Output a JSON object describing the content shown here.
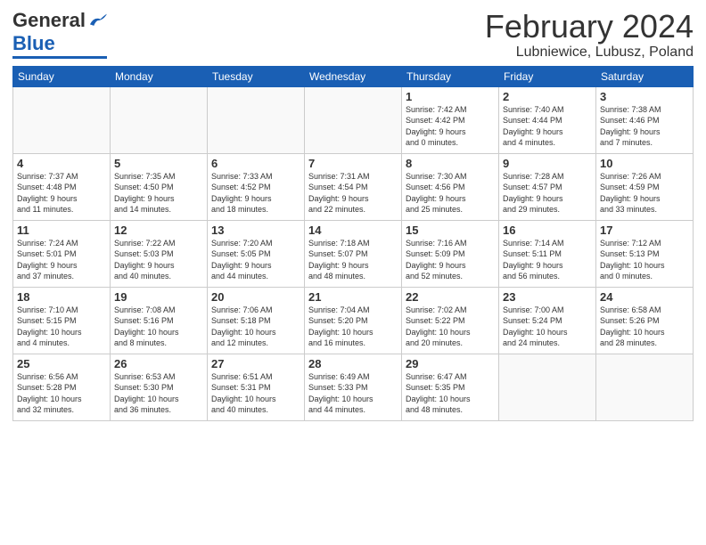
{
  "header": {
    "logo_general": "General",
    "logo_blue": "Blue",
    "month": "February 2024",
    "location": "Lubniewice, Lubusz, Poland"
  },
  "weekdays": [
    "Sunday",
    "Monday",
    "Tuesday",
    "Wednesday",
    "Thursday",
    "Friday",
    "Saturday"
  ],
  "weeks": [
    [
      {
        "day": "",
        "info": ""
      },
      {
        "day": "",
        "info": ""
      },
      {
        "day": "",
        "info": ""
      },
      {
        "day": "",
        "info": ""
      },
      {
        "day": "1",
        "info": "Sunrise: 7:42 AM\nSunset: 4:42 PM\nDaylight: 9 hours\nand 0 minutes."
      },
      {
        "day": "2",
        "info": "Sunrise: 7:40 AM\nSunset: 4:44 PM\nDaylight: 9 hours\nand 4 minutes."
      },
      {
        "day": "3",
        "info": "Sunrise: 7:38 AM\nSunset: 4:46 PM\nDaylight: 9 hours\nand 7 minutes."
      }
    ],
    [
      {
        "day": "4",
        "info": "Sunrise: 7:37 AM\nSunset: 4:48 PM\nDaylight: 9 hours\nand 11 minutes."
      },
      {
        "day": "5",
        "info": "Sunrise: 7:35 AM\nSunset: 4:50 PM\nDaylight: 9 hours\nand 14 minutes."
      },
      {
        "day": "6",
        "info": "Sunrise: 7:33 AM\nSunset: 4:52 PM\nDaylight: 9 hours\nand 18 minutes."
      },
      {
        "day": "7",
        "info": "Sunrise: 7:31 AM\nSunset: 4:54 PM\nDaylight: 9 hours\nand 22 minutes."
      },
      {
        "day": "8",
        "info": "Sunrise: 7:30 AM\nSunset: 4:56 PM\nDaylight: 9 hours\nand 25 minutes."
      },
      {
        "day": "9",
        "info": "Sunrise: 7:28 AM\nSunset: 4:57 PM\nDaylight: 9 hours\nand 29 minutes."
      },
      {
        "day": "10",
        "info": "Sunrise: 7:26 AM\nSunset: 4:59 PM\nDaylight: 9 hours\nand 33 minutes."
      }
    ],
    [
      {
        "day": "11",
        "info": "Sunrise: 7:24 AM\nSunset: 5:01 PM\nDaylight: 9 hours\nand 37 minutes."
      },
      {
        "day": "12",
        "info": "Sunrise: 7:22 AM\nSunset: 5:03 PM\nDaylight: 9 hours\nand 40 minutes."
      },
      {
        "day": "13",
        "info": "Sunrise: 7:20 AM\nSunset: 5:05 PM\nDaylight: 9 hours\nand 44 minutes."
      },
      {
        "day": "14",
        "info": "Sunrise: 7:18 AM\nSunset: 5:07 PM\nDaylight: 9 hours\nand 48 minutes."
      },
      {
        "day": "15",
        "info": "Sunrise: 7:16 AM\nSunset: 5:09 PM\nDaylight: 9 hours\nand 52 minutes."
      },
      {
        "day": "16",
        "info": "Sunrise: 7:14 AM\nSunset: 5:11 PM\nDaylight: 9 hours\nand 56 minutes."
      },
      {
        "day": "17",
        "info": "Sunrise: 7:12 AM\nSunset: 5:13 PM\nDaylight: 10 hours\nand 0 minutes."
      }
    ],
    [
      {
        "day": "18",
        "info": "Sunrise: 7:10 AM\nSunset: 5:15 PM\nDaylight: 10 hours\nand 4 minutes."
      },
      {
        "day": "19",
        "info": "Sunrise: 7:08 AM\nSunset: 5:16 PM\nDaylight: 10 hours\nand 8 minutes."
      },
      {
        "day": "20",
        "info": "Sunrise: 7:06 AM\nSunset: 5:18 PM\nDaylight: 10 hours\nand 12 minutes."
      },
      {
        "day": "21",
        "info": "Sunrise: 7:04 AM\nSunset: 5:20 PM\nDaylight: 10 hours\nand 16 minutes."
      },
      {
        "day": "22",
        "info": "Sunrise: 7:02 AM\nSunset: 5:22 PM\nDaylight: 10 hours\nand 20 minutes."
      },
      {
        "day": "23",
        "info": "Sunrise: 7:00 AM\nSunset: 5:24 PM\nDaylight: 10 hours\nand 24 minutes."
      },
      {
        "day": "24",
        "info": "Sunrise: 6:58 AM\nSunset: 5:26 PM\nDaylight: 10 hours\nand 28 minutes."
      }
    ],
    [
      {
        "day": "25",
        "info": "Sunrise: 6:56 AM\nSunset: 5:28 PM\nDaylight: 10 hours\nand 32 minutes."
      },
      {
        "day": "26",
        "info": "Sunrise: 6:53 AM\nSunset: 5:30 PM\nDaylight: 10 hours\nand 36 minutes."
      },
      {
        "day": "27",
        "info": "Sunrise: 6:51 AM\nSunset: 5:31 PM\nDaylight: 10 hours\nand 40 minutes."
      },
      {
        "day": "28",
        "info": "Sunrise: 6:49 AM\nSunset: 5:33 PM\nDaylight: 10 hours\nand 44 minutes."
      },
      {
        "day": "29",
        "info": "Sunrise: 6:47 AM\nSunset: 5:35 PM\nDaylight: 10 hours\nand 48 minutes."
      },
      {
        "day": "",
        "info": ""
      },
      {
        "day": "",
        "info": ""
      }
    ]
  ]
}
